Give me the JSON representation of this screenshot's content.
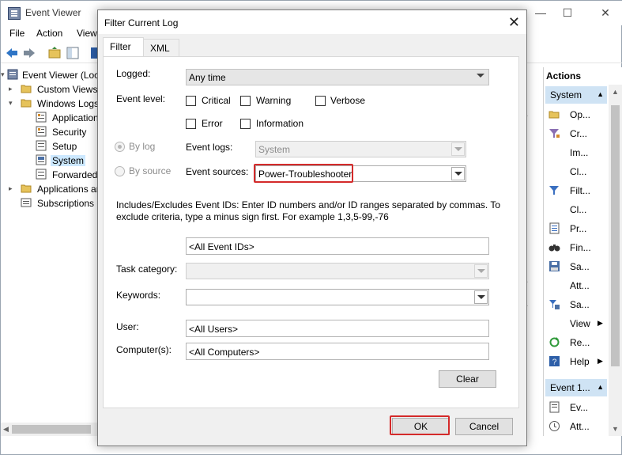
{
  "window": {
    "title": "Event Viewer",
    "minimize": "—",
    "maximize": "☐",
    "close": "✕"
  },
  "menu": [
    "File",
    "Action",
    "View"
  ],
  "tree": [
    {
      "label": "Event Viewer (Local)",
      "expander": "▾",
      "selected": false
    },
    {
      "label": "Custom Views",
      "expander": "▸",
      "selected": false
    },
    {
      "label": "Windows Logs",
      "expander": "▾",
      "selected": false
    },
    {
      "label": "Application",
      "expander": "",
      "selected": false
    },
    {
      "label": "Security",
      "expander": "",
      "selected": false
    },
    {
      "label": "Setup",
      "expander": "",
      "selected": false
    },
    {
      "label": "System",
      "expander": "",
      "selected": true
    },
    {
      "label": "Forwarded Events",
      "expander": "",
      "selected": false
    },
    {
      "label": "Applications and Services Logs",
      "expander": "▸",
      "selected": false
    },
    {
      "label": "Subscriptions",
      "expander": "",
      "selected": false
    }
  ],
  "actions": {
    "header": "Actions",
    "group1": "System",
    "group1_arrow": "▲",
    "items1": [
      {
        "label": "Op...",
        "icon": "open-folder-icon"
      },
      {
        "label": "Cr...",
        "icon": "funnel-create-icon"
      },
      {
        "label": "Im...",
        "icon": ""
      },
      {
        "label": "Cl...",
        "icon": ""
      },
      {
        "label": "Filt...",
        "icon": "filter-icon"
      },
      {
        "label": "Cl...",
        "icon": ""
      },
      {
        "label": "Pr...",
        "icon": "properties-icon"
      },
      {
        "label": "Fin...",
        "icon": "binoculars-icon"
      },
      {
        "label": "Sa...",
        "icon": "save-icon"
      },
      {
        "label": "Att...",
        "icon": ""
      },
      {
        "label": "Sa...",
        "icon": "save-filter-icon"
      },
      {
        "label": "View",
        "icon": "",
        "submenu": "▶"
      },
      {
        "label": "Re...",
        "icon": "refresh-icon"
      },
      {
        "label": "Help",
        "icon": "help-icon",
        "submenu": "▶"
      }
    ],
    "group2": "Event 1...",
    "group2_arrow": "▲",
    "items2": [
      {
        "label": "Ev...",
        "icon": "event-properties-icon"
      },
      {
        "label": "Att...",
        "icon": "attach-task-icon"
      }
    ]
  },
  "dialog": {
    "title": "Filter Current Log",
    "close": "✕",
    "tabs": [
      "Filter",
      "XML"
    ],
    "logged_label": "Logged:",
    "logged_value": "Any time",
    "event_level_label": "Event level:",
    "levels": [
      "Critical",
      "Warning",
      "Verbose",
      "Error",
      "Information"
    ],
    "by_log_label": "By log",
    "by_source_label": "By source",
    "event_logs_label": "Event logs:",
    "event_logs_value": "System",
    "event_sources_label": "Event sources:",
    "event_sources_value": "Power-Troubleshooter",
    "description": "Includes/Excludes Event IDs: Enter ID numbers and/or ID ranges separated by commas. To exclude criteria, type a minus sign first. For example 1,3,5-99,-76",
    "event_ids_value": "<All Event IDs>",
    "task_category_label": "Task category:",
    "task_category_value": "",
    "keywords_label": "Keywords:",
    "keywords_value": "",
    "user_label": "User:",
    "user_value": "<All Users>",
    "computer_label": "Computer(s):",
    "computer_value": "<All Computers>",
    "clear_label": "Clear",
    "ok_label": "OK",
    "cancel_label": "Cancel"
  },
  "colors": {
    "highlight_red": "#d42a2a",
    "selection_blue": "#cce8ff",
    "group_header": "#cfe3f4"
  }
}
